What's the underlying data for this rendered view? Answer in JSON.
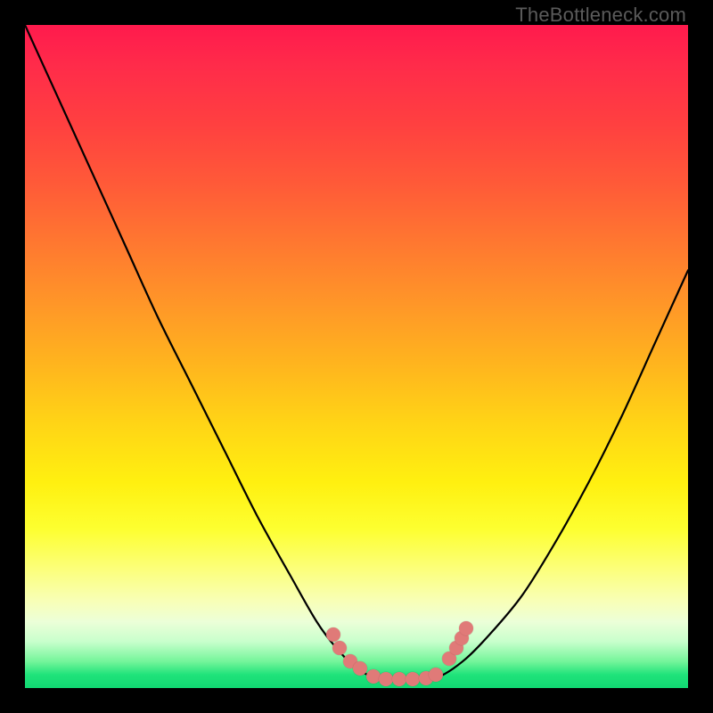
{
  "watermark": "TheBottleneck.com",
  "colors": {
    "frame": "#000000",
    "dot": "#e07a78",
    "curve": "#000000",
    "gradient_top": "#ff1a4d",
    "gradient_bottom": "#11d872"
  },
  "chart_data": {
    "type": "line",
    "title": "",
    "xlabel": "",
    "ylabel": "",
    "xlim": [
      0,
      100
    ],
    "ylim": [
      0,
      100
    ],
    "note": "Axes unlabeled in source image; x expressed left→right 0–100, y expressed bottom→top 0–100 (0 = green/good, 100 = red/bottleneck). Curve values are estimated from pixel positions.",
    "series": [
      {
        "name": "bottleneck-curve",
        "x": [
          0,
          5,
          10,
          15,
          20,
          25,
          30,
          35,
          40,
          44,
          47,
          50,
          53,
          56,
          59,
          62,
          66,
          70,
          75,
          80,
          85,
          90,
          95,
          100
        ],
        "y": [
          100,
          89,
          78,
          67,
          56,
          46,
          36,
          26,
          17,
          10,
          6,
          3,
          1.5,
          1.2,
          1.2,
          1.5,
          4,
          8,
          14,
          22,
          31,
          41,
          52,
          63
        ]
      }
    ],
    "markers": {
      "name": "highlight-dots",
      "note": "Salmon circular markers clustered near the curve minimum. Coordinates in same 0–100 space as series.",
      "points": [
        {
          "x": 46.5,
          "y": 8.0
        },
        {
          "x": 47.5,
          "y": 6.0
        },
        {
          "x": 49.0,
          "y": 4.0
        },
        {
          "x": 50.5,
          "y": 3.0
        },
        {
          "x": 52.5,
          "y": 1.8
        },
        {
          "x": 54.5,
          "y": 1.4
        },
        {
          "x": 56.5,
          "y": 1.3
        },
        {
          "x": 58.5,
          "y": 1.3
        },
        {
          "x": 60.5,
          "y": 1.5
        },
        {
          "x": 62.0,
          "y": 2.0
        },
        {
          "x": 64.0,
          "y": 4.5
        },
        {
          "x": 65.0,
          "y": 6.0
        },
        {
          "x": 65.8,
          "y": 7.5
        },
        {
          "x": 66.5,
          "y": 9.0
        }
      ]
    }
  }
}
